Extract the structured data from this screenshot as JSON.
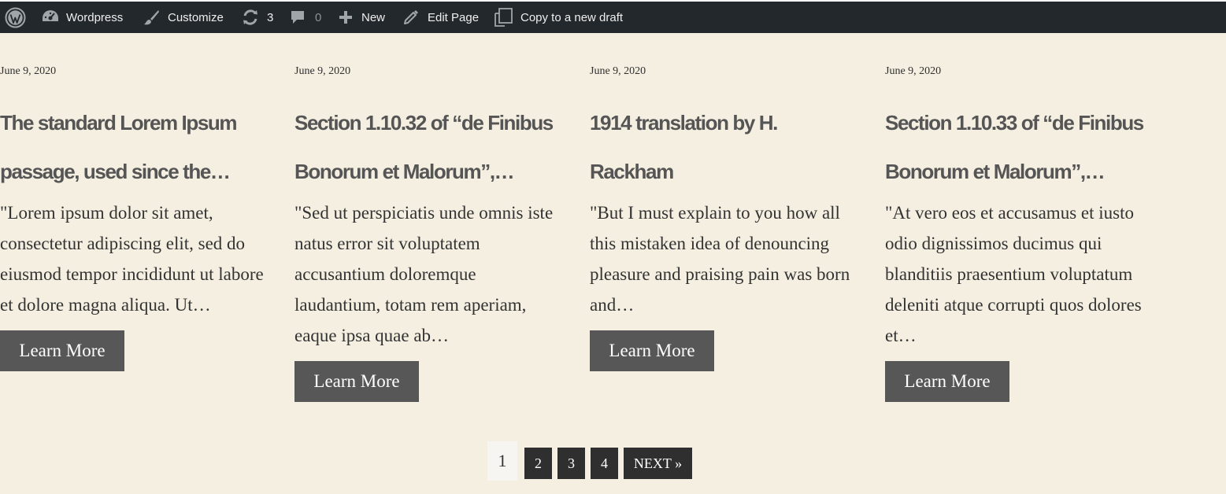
{
  "admin_bar": {
    "site_name": "Wordpress",
    "customize_label": "Customize",
    "updates_count": "3",
    "comments_count": "0",
    "new_label": "New",
    "edit_page_label": "Edit Page",
    "copy_draft_label": "Copy to a new draft"
  },
  "posts": [
    {
      "date": "June 9, 2020",
      "title": "The standard Lorem Ipsum passage, used since the…",
      "excerpt": "\"Lorem ipsum dolor sit amet, consectetur adipiscing elit, sed do eiusmod tempor incididunt ut labore et dolore magna aliqua. Ut…",
      "button_label": "Learn More"
    },
    {
      "date": "June 9, 2020",
      "title": "Section 1.10.32 of “de Finibus Bonorum et Malorum”,…",
      "excerpt": "\"Sed ut perspiciatis unde omnis iste natus error sit voluptatem accusantium doloremque laudantium, totam rem aperiam, eaque ipsa quae ab…",
      "button_label": "Learn More"
    },
    {
      "date": "June 9, 2020",
      "title": "1914 translation by H. Rackham",
      "excerpt": "\"But I must explain to you how all this mistaken idea of denouncing pleasure and praising pain was born and…",
      "button_label": "Learn More"
    },
    {
      "date": "June 9, 2020",
      "title": "Section 1.10.33 of “de Finibus Bonorum et Malorum”,…",
      "excerpt": "\"At vero eos et accusamus et iusto odio dignissimos ducimus qui blanditiis praesentium voluptatum deleniti atque corrupti quos dolores et…",
      "button_label": "Learn More"
    }
  ],
  "pagination": {
    "current": "1",
    "pages": [
      "2",
      "3",
      "4"
    ],
    "next_label": "NEXT »"
  },
  "colors": {
    "page_background": "#f5efe1",
    "admin_bar": "#23282d",
    "button": "#575757",
    "pagination_button": "#2f2f2f"
  },
  "icons": {
    "wordpress": "wordpress-logo-icon",
    "dashboard": "dashboard-icon",
    "customize": "paintbrush-icon",
    "updates": "updates-icon",
    "comments": "comment-icon",
    "new": "plus-icon",
    "edit": "pencil-icon",
    "copy": "copy-draft-icon"
  }
}
